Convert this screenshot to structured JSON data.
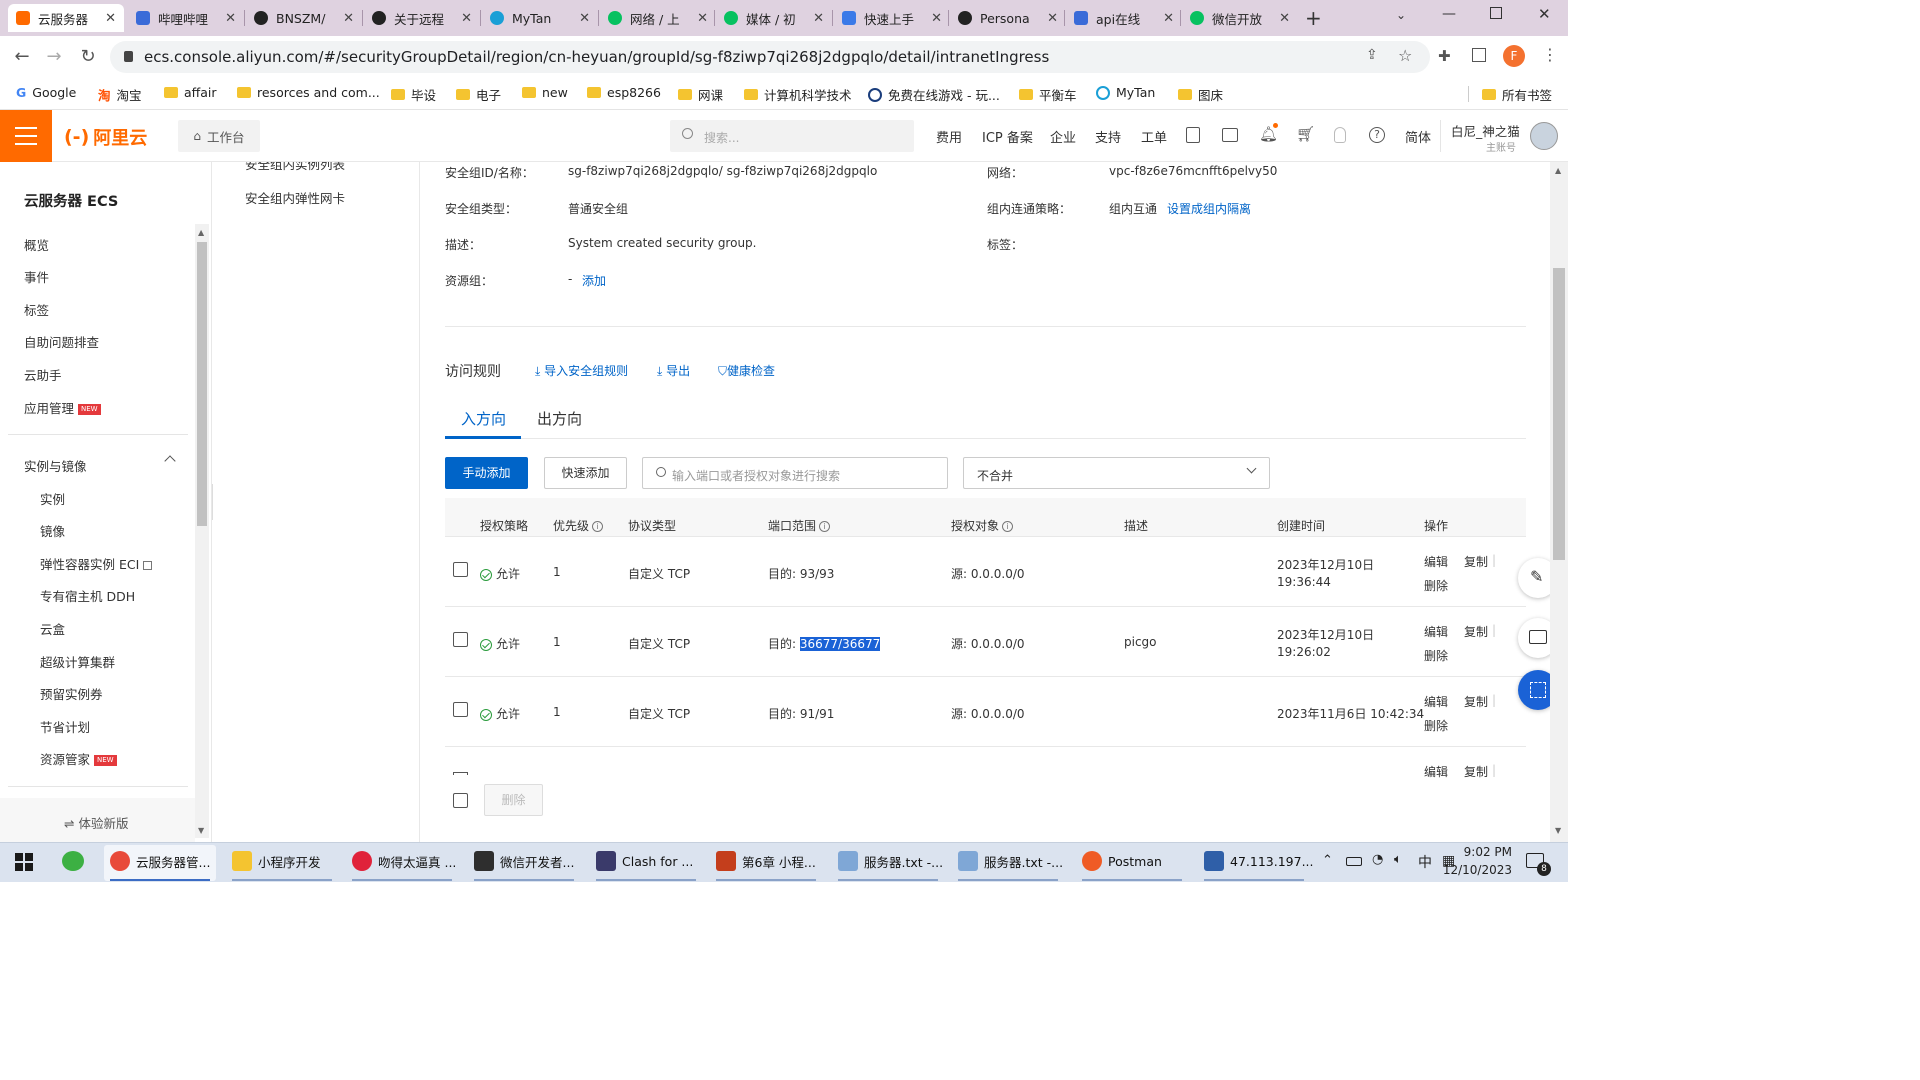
{
  "browser": {
    "tabs": [
      {
        "label": "云服务器",
        "color": "#ff6a00",
        "active": true
      },
      {
        "label": "哔哩哔哩",
        "color": "#3a6bd8"
      },
      {
        "label": "BNSZM/",
        "color": "#222222"
      },
      {
        "label": "关于远程",
        "color": "#222222"
      },
      {
        "label": "MyTan",
        "color": "#1a9fd6"
      },
      {
        "label": "网络 / 上",
        "color": "#07c160"
      },
      {
        "label": "媒体 / 初",
        "color": "#07c160"
      },
      {
        "label": "快速上手",
        "color": "#3b7ae8"
      },
      {
        "label": "Persona",
        "color": "#222222"
      },
      {
        "label": "api在线",
        "color": "#3a6bd8"
      },
      {
        "label": "微信开放",
        "color": "#07c160"
      }
    ],
    "url": "ecs.console.aliyun.com/#/securityGroupDetail/region/cn-heyuan/groupId/sg-f8ziwp7qi268j2dgpqlo/detail/intranetIngress",
    "profile_letter": "F",
    "bookmarks": [
      "Google",
      "淘宝",
      "affair",
      "resorces and com...",
      "毕设",
      "电子",
      "new",
      "esp8266",
      "网课",
      "计算机科学技术",
      "免费在线游戏 - 玩...",
      "平衡车",
      "MyTan",
      "图床"
    ],
    "bookmarks_all": "所有书签"
  },
  "console": {
    "logo": "阿里云",
    "workbench": "工作台",
    "search_placeholder": "搜索...",
    "topnav": [
      "费用",
      "ICP 备案",
      "企业",
      "支持",
      "工单"
    ],
    "lang": "简体",
    "user_name": "白尼_神之猫",
    "user_role": "主账号"
  },
  "sidebar": {
    "title": "云服务器 ECS",
    "items": [
      "概览",
      "事件",
      "标签",
      "自助问题排查",
      "云助手",
      "应用管理"
    ],
    "section": "实例与镜像",
    "subitems": [
      "实例",
      "镜像",
      "弹性容器实例 ECI",
      "专有宿主机 DDH",
      "云盒",
      "超级计算集群",
      "预留实例券",
      "节省计划",
      "资源管家"
    ],
    "new_badge": "NEW",
    "footer": "体验新版"
  },
  "subnav": {
    "items": [
      "安全组内实例列表",
      "安全组内弹性网卡"
    ]
  },
  "details": {
    "id_label": "安全组ID/名称：",
    "id_value": "sg-f8ziwp7qi268j2dgpqlo/ sg-f8ziwp7qi268j2dgpqlo",
    "type_label": "安全组类型：",
    "type_value": "普通安全组",
    "desc_label": "描述：",
    "desc_value": "System created security group.",
    "rg_label": "资源组：",
    "rg_value": "-",
    "rg_add": "添加",
    "net_label": "网络：",
    "net_value": "vpc-f8z6e76mcnfft6pelvy50",
    "policy_label": "组内连通策略：",
    "policy_value": "组内互通",
    "policy_link": "设置成组内隔离",
    "tags_label": "标签："
  },
  "rules": {
    "title": "访问规则",
    "import": "导入安全组规则",
    "export": "导出",
    "health": "健康检查",
    "tab_in": "入方向",
    "tab_out": "出方向",
    "manual_add": "手动添加",
    "quick_add": "快速添加",
    "search_placeholder": "输入端口或者授权对象进行搜索",
    "merge_select": "不合并",
    "delete": "删除",
    "headers": [
      "授权策略",
      "优先级",
      "协议类型",
      "端口范围",
      "授权对象",
      "描述",
      "创建时间",
      "操作"
    ],
    "rows": [
      {
        "policy": "允许",
        "priority": "1",
        "protocol": "自定义 TCP",
        "port_prefix": "目的: ",
        "port": "93/93",
        "source": "源: 0.0.0.0/0",
        "desc": "",
        "created1": "2023年12月10日",
        "created2": "19:36:44"
      },
      {
        "policy": "允许",
        "priority": "1",
        "protocol": "自定义 TCP",
        "port_prefix": "目的: ",
        "port": "36677/36677",
        "source": "源: 0.0.0.0/0",
        "desc": "picgo",
        "created1": "2023年12月10日",
        "created2": "19:26:02"
      },
      {
        "policy": "允许",
        "priority": "1",
        "protocol": "自定义 TCP",
        "port_prefix": "目的: ",
        "port": "91/91",
        "source": "源: 0.0.0.0/0",
        "desc": "",
        "created1": "2023年11月6日 10:42:34",
        "created2": ""
      }
    ],
    "op_edit": "编辑",
    "op_copy": "复制",
    "op_delete": "删除"
  },
  "taskbar": {
    "apps": [
      "云服务器管...",
      "小程序开发",
      "吻得太逼真 ...",
      "微信开发者...",
      "Clash for ...",
      "第6章 小程...",
      "服务器.txt -...",
      "服务器.txt -...",
      "Postman",
      "47.113.197..."
    ],
    "ime": "中",
    "time": "9:02 PM",
    "date": "12/10/2023",
    "notif_count": "8"
  },
  "colors": {
    "accent": "#0064c8",
    "brand": "#ff6a00",
    "ok": "#2b9b3c"
  }
}
